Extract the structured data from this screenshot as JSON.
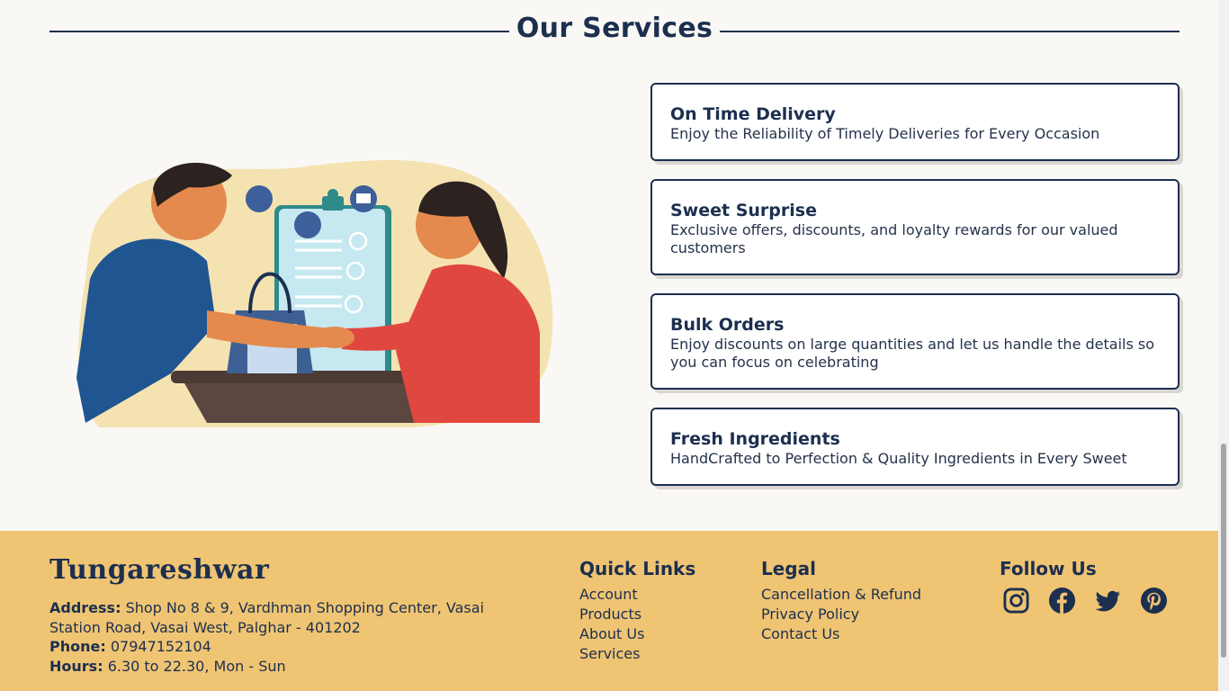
{
  "services": {
    "title": "Our Services",
    "cards": [
      {
        "title": "On Time Delivery",
        "desc": "Enjoy the Reliability of Timely Deliveries for Every Occasion"
      },
      {
        "title": "Sweet Surprise",
        "desc": "Exclusive offers, discounts, and loyalty rewards for our valued customers"
      },
      {
        "title": "Bulk Orders",
        "desc": "Enjoy discounts on large quantities and let us handle the details so you can focus on celebrating"
      },
      {
        "title": "Fresh Ingredients",
        "desc": "HandCrafted to Perfection & Quality Ingredients in Every Sweet"
      }
    ]
  },
  "footer": {
    "brand": "Tungareshwar",
    "address_label": "Address:",
    "address": "Shop No 8 & 9, Vardhman Shopping Center, Vasai Station Road, Vasai West, Palghar - 401202",
    "phone_label": "Phone:",
    "phone": "07947152104",
    "hours_label": "Hours:",
    "hours": "6.30 to 22.30, Mon - Sun",
    "quick_links": {
      "title": "Quick Links",
      "items": [
        "Account",
        "Products",
        "About Us",
        "Services"
      ]
    },
    "legal": {
      "title": "Legal",
      "items": [
        "Cancellation & Refund",
        "Privacy Policy",
        "Contact Us"
      ]
    },
    "follow": {
      "title": "Follow Us",
      "icons": [
        "instagram-icon",
        "facebook-icon",
        "twitter-icon",
        "pinterest-icon"
      ]
    }
  },
  "colors": {
    "navy": "#1c2f4f",
    "footer_bg": "#efc473",
    "page_bg": "#faf8f5"
  }
}
